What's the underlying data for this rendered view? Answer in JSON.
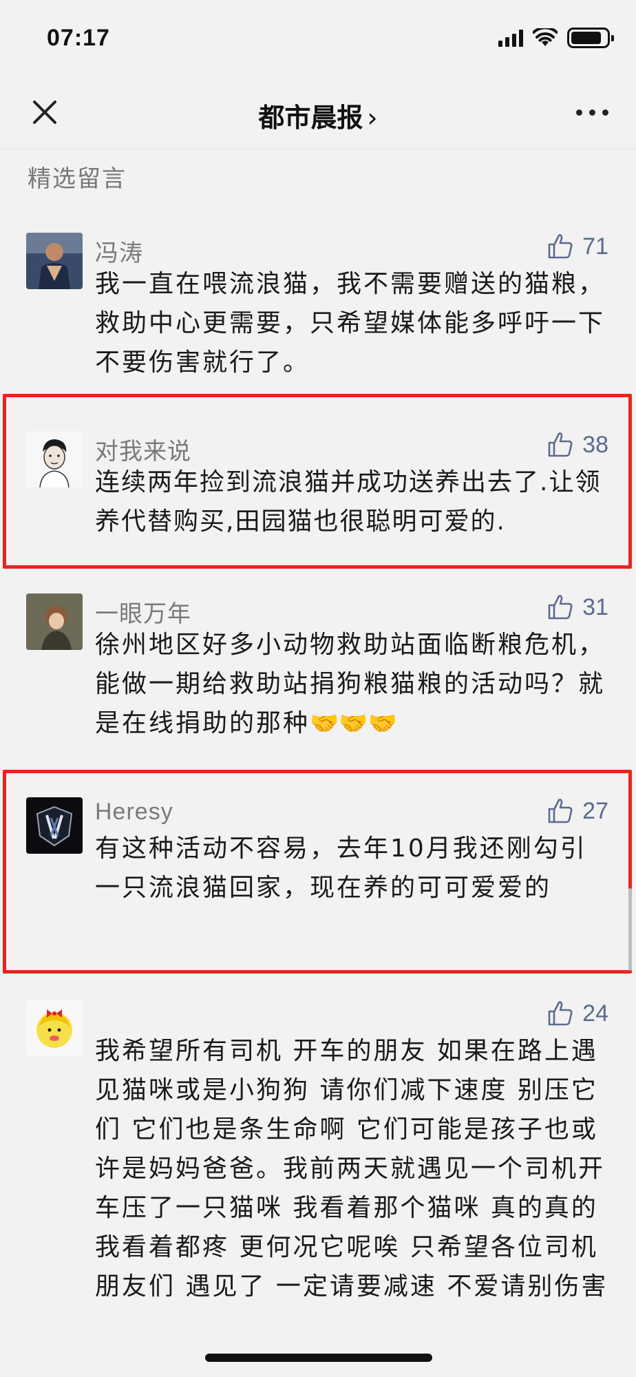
{
  "status_bar": {
    "time": "07:17"
  },
  "nav": {
    "title": "都市晨报",
    "chevron": "›"
  },
  "section": {
    "label": "精选留言"
  },
  "comments": [
    {
      "author": "冯涛",
      "likes": "71",
      "text": "我一直在喂流浪猫，我不需要赠送的猫粮，救助中心更需要，只希望媒体能多呼吁一下不要伤害就行了。"
    },
    {
      "author": "对我来说",
      "likes": "38",
      "text": "连续两年捡到流浪猫并成功送养出去了.让领养代替购买,田园猫也很聪明可爱的."
    },
    {
      "author": "一眼万年",
      "likes": "31",
      "text": "徐州地区好多小动物救助站面临断粮危机，能做一期给救助站捐狗粮猫粮的活动吗？就是在线捐助的那种",
      "emoji": "🤝🤝🤝"
    },
    {
      "author": "Heresy",
      "likes": "27",
      "text": "有这种活动不容易，去年10月我还刚勾引一只流浪猫回家，现在养的可可爱爱的"
    },
    {
      "author": "",
      "likes": "24",
      "text": "我希望所有司机 开车的朋友 如果在路上遇见猫咪或是小狗狗 请你们减下速度 别压它们 它们也是条生命啊 它们可能是孩子也或许是妈妈爸爸。我前两天就遇见一个司机开车压了一只猫咪 我看着那个猫咪 真的真的 我看着都疼 更何况它呢唉 只希望各位司机朋友们 遇见了 一定请要减速 不爱请别伤害"
    }
  ],
  "colors": {
    "highlight": "#e8251f",
    "like": "#5b6a8e",
    "author": "#7a7a7a",
    "background": "#f2f2f2"
  },
  "icons": [
    "close-icon",
    "more-icon",
    "thumb-up-icon",
    "signal-icon",
    "wifi-icon",
    "battery-icon"
  ]
}
